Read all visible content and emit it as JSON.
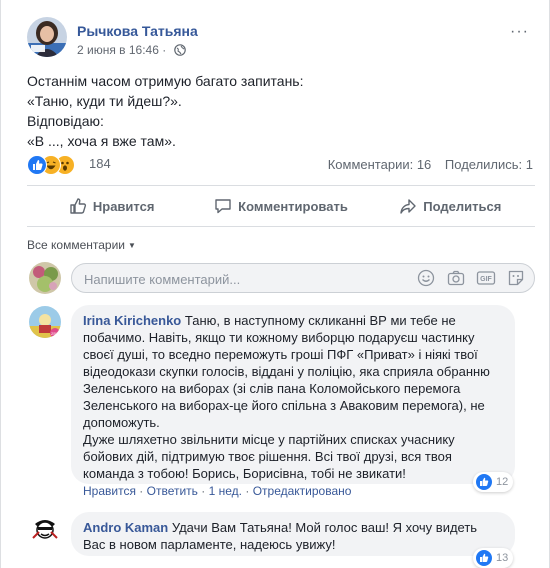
{
  "post": {
    "author": "Рычкова Татьяна",
    "timestamp": "2 июня в 16:46",
    "privacy_icon": "globe-icon",
    "more_icon": "···",
    "text_lines": [
      "Останнім часом отримую багато запитань:",
      "«Таню, куди ти йдеш?».",
      "Відповідаю:",
      "«В ..., хоча я вже там»."
    ],
    "reaction_count": "184",
    "reaction_icons": [
      "like-icon",
      "haha-icon",
      "wow-icon"
    ],
    "comments_stat": "Комментарии: 16",
    "shares_stat": "Поделились: 1"
  },
  "actions": {
    "like": "Нравится",
    "comment": "Комментировать",
    "share": "Поделиться"
  },
  "comments_filter": {
    "label": "Все комментарии"
  },
  "composer": {
    "placeholder": "Напишите комментарий..."
  },
  "comments": [
    {
      "author": "Irina Kirichenko",
      "lines": [
        " Таню, в наступному скликанні ВР ми тебе не",
        "побачимо. Навіть, якщо ти кожному виборцю подаруєш частинку",
        "своєї душі, то вседно переможуть гроші ПФГ «Приват» і ніякі твої",
        "відеодокази скупки голосів, віддані у поліцію, яка сприяла обранню",
        "Зеленського на виборах (зі слів пана Коломойського перемога",
        "Зеленського на виборах-це його спільна з Аваковим перемога), не",
        "допоможуть.",
        "Дуже шляхетно звільнити місце у партійних списках учаснику",
        "бойових дій, підтримую твоє рішення. Всі твої друзі, вся твоя",
        "команда з тобою! Борись, Борисівна, тобі не звикати!"
      ],
      "like_label": "Нравится",
      "reply_label": "Ответить",
      "age": "1 нед.",
      "edited": "Отредактировано",
      "likes": "12"
    },
    {
      "author": "Andro Kaman",
      "lines": [
        " Удачи Вам Татьяна! Мой голос ваш! Я хочу видеть",
        "Вас в новом парламенте, надеюсь увижу!"
      ],
      "likes": "13"
    }
  ],
  "colors": {
    "link": "#365899",
    "like_blue": "#2078f4",
    "bubble_bg": "#f2f3f5",
    "meta_gray": "#606770"
  }
}
